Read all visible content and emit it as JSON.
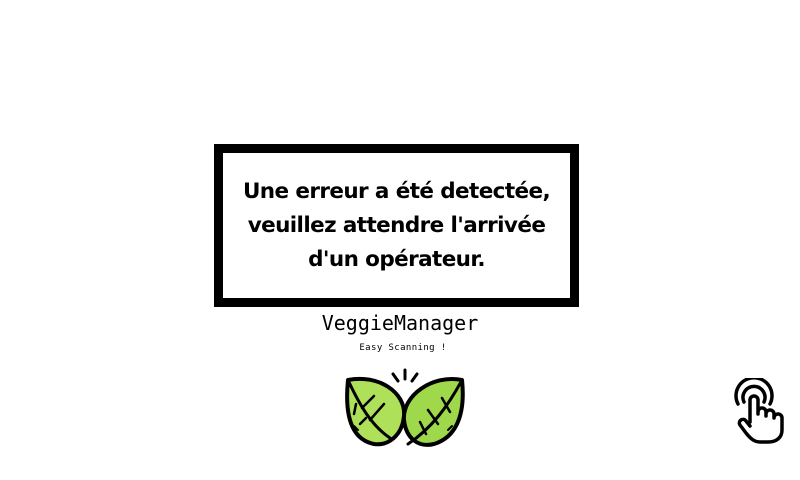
{
  "error": {
    "message_lines": [
      "Une erreur a été detectée,",
      "veuillez attendre l'arrivée",
      "d'un opérateur."
    ]
  },
  "brand": {
    "title": "VeggieManager",
    "tagline": "Easy Scanning !"
  },
  "logo": {
    "icon": "leaves-icon",
    "colors": {
      "leaf_light": "#aee05a",
      "leaf_dark": "#7cc23a",
      "outline": "#000000"
    }
  },
  "touch": {
    "icon": "tap-hand-icon"
  },
  "colors": {
    "background": "#ffffff",
    "border": "#000000",
    "text": "#000000"
  }
}
